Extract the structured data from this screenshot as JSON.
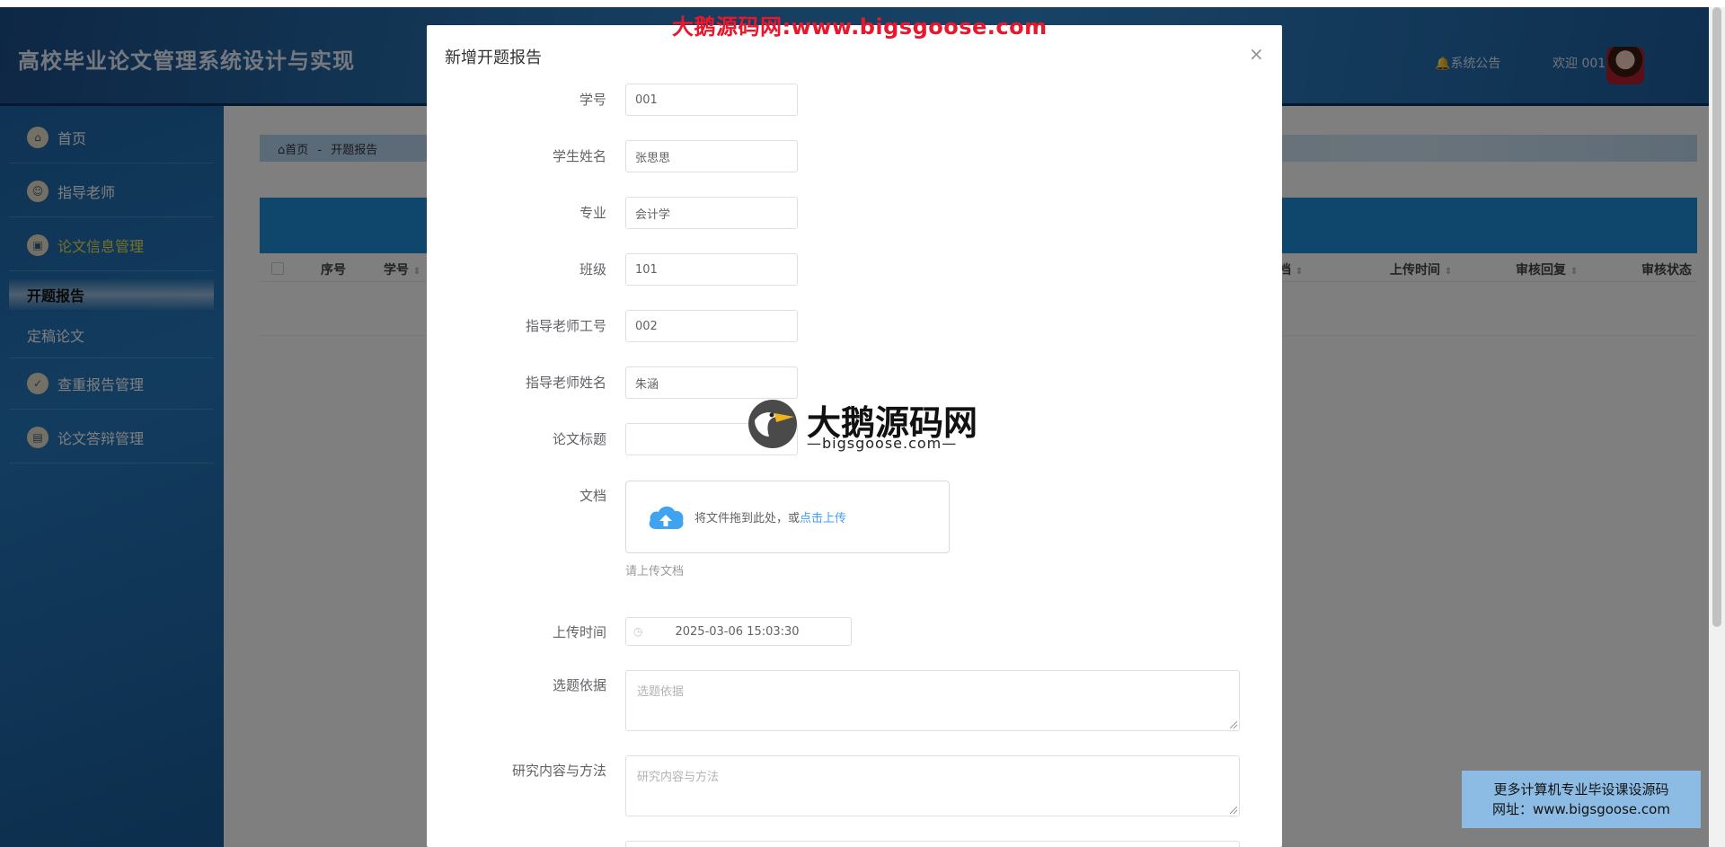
{
  "app": {
    "title": "高校毕业论文管理系统设计与实现"
  },
  "header": {
    "notice": "系统公告",
    "welcome": "欢迎 001"
  },
  "sidebar": {
    "items": [
      {
        "label": "首页"
      },
      {
        "label": "指导老师"
      },
      {
        "label": "论文信息管理"
      },
      {
        "label": "查重报告管理"
      },
      {
        "label": "论文答辩管理"
      }
    ],
    "sub_items": [
      {
        "label": "开题报告"
      },
      {
        "label": "定稿论文"
      }
    ]
  },
  "breadcrumb": {
    "home": "首页",
    "sep": "-",
    "current": "开题报告"
  },
  "table": {
    "headers": [
      "序号",
      "学号",
      "档",
      "上传时间",
      "审核回复",
      "审核状态"
    ]
  },
  "dialog": {
    "title": "新增开题报告",
    "close": "×",
    "fields": {
      "student_no": {
        "label": "学号",
        "value": "001"
      },
      "student_name": {
        "label": "学生姓名",
        "value": "张思思"
      },
      "major": {
        "label": "专业",
        "value": "会计学"
      },
      "class": {
        "label": "班级",
        "value": "101"
      },
      "teacher_no": {
        "label": "指导老师工号",
        "value": "002"
      },
      "teacher_name": {
        "label": "指导老师姓名",
        "value": "朱涵"
      },
      "thesis_title": {
        "label": "论文标题",
        "value": ""
      },
      "document": {
        "label": "文档",
        "upload_text": "将文件拖到此处，或",
        "upload_link": "点击上传",
        "tip": "请上传文档"
      },
      "upload_time": {
        "label": "上传时间",
        "value": "2025-03-06 15:03:30"
      },
      "basis": {
        "label": "选题依据",
        "placeholder": "选题依据"
      },
      "research": {
        "label": "研究内容与方法",
        "placeholder": "研究内容与方法"
      }
    }
  },
  "watermarks": {
    "top": "大鹅源码网:www.bigsgoose.com",
    "logo_main": "大鹅源码网",
    "logo_sub": "—bigsgoose.com—",
    "ad_line1": "更多计算机专业毕设课设源码",
    "ad_line2": "网址：www.bigsgoose.com"
  },
  "colors": {
    "header": "#2b78b8",
    "accent": "#409eff",
    "watermark_red": "#e8172d",
    "active_menu": "#f3e04a"
  }
}
